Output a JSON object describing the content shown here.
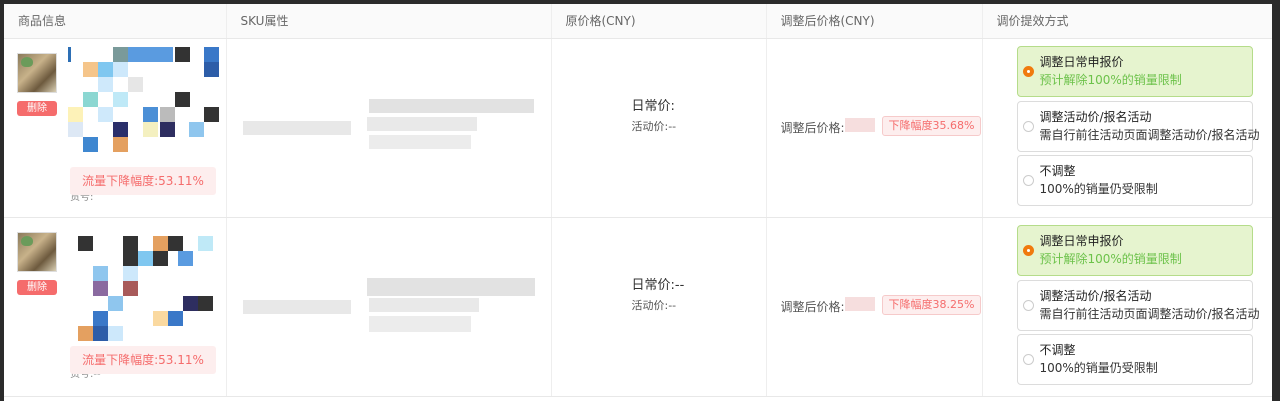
{
  "headers": [
    "商品信息",
    "SKU属性",
    "原价格(CNY)",
    "调整后价格(CNY)",
    "调价提效方式"
  ],
  "rows": [
    {
      "delete_label": "删除",
      "traffic_drop": "流量下降幅度:53.11%",
      "cut_text": "货号:",
      "daily_price": "日常价:",
      "activity_price": "活动价:--",
      "adjusted_label": "调整后价格:",
      "drop_tag": "下降幅度35.68%",
      "options": [
        {
          "title": "调整日常申报价",
          "sub": "预计解除100%的销量限制",
          "selected": true
        },
        {
          "title": "调整活动价/报名活动",
          "sub": "需自行前往活动页面调整活动价/报名活动",
          "selected": false
        },
        {
          "title": "不调整",
          "sub": "100%的销量仍受限制",
          "selected": false
        }
      ]
    },
    {
      "delete_label": "删除",
      "traffic_drop": "流量下降幅度:53.11%",
      "cut_text": "货号:--",
      "daily_price": "日常价:--",
      "activity_price": "活动价:--",
      "adjusted_label": "调整后价格:",
      "drop_tag": "下降幅度38.25%",
      "options": [
        {
          "title": "调整日常申报价",
          "sub": "预计解除100%的销量限制",
          "selected": true
        },
        {
          "title": "调整活动价/报名活动",
          "sub": "需自行前往活动页面调整活动价/报名活动",
          "selected": false
        },
        {
          "title": "不调整",
          "sub": "100%的销量仍受限制",
          "selected": false
        }
      ]
    }
  ],
  "colors": {
    "selected_bg": "#e6f4cf",
    "selected_text": "#6cc24a",
    "radio_checked": "#f07a0e",
    "danger": "#f56c6c"
  }
}
